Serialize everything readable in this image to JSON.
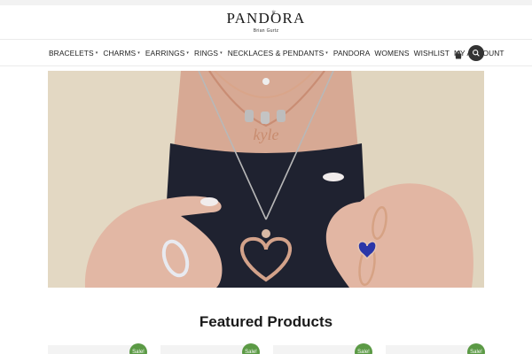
{
  "brand": {
    "logo_text": "PANDORA",
    "logo_sub": "Brian Gurtz",
    "crown_glyph": "♛"
  },
  "nav": {
    "items": [
      {
        "label": "BRACELETS",
        "has_dropdown": true
      },
      {
        "label": "CHARMS",
        "has_dropdown": true
      },
      {
        "label": "EARRINGS",
        "has_dropdown": true
      },
      {
        "label": "RINGS",
        "has_dropdown": true
      },
      {
        "label": "NECKLACES & PENDANTS",
        "has_dropdown": true
      },
      {
        "label": "PANDORA",
        "has_dropdown": false
      },
      {
        "label": "WOMENS",
        "has_dropdown": false
      },
      {
        "label": "WISHLIST",
        "has_dropdown": false
      },
      {
        "label": "MY ACCOUNT",
        "has_dropdown": false
      }
    ],
    "caret_glyph": "▾",
    "cart_icon": "shopping-bag-icon",
    "search_icon": "search-icon"
  },
  "hero": {
    "charm_letters": "kyle"
  },
  "featured": {
    "title": "Featured Products",
    "badge_label": "Sale!",
    "badge_color": "#5b9a45"
  }
}
